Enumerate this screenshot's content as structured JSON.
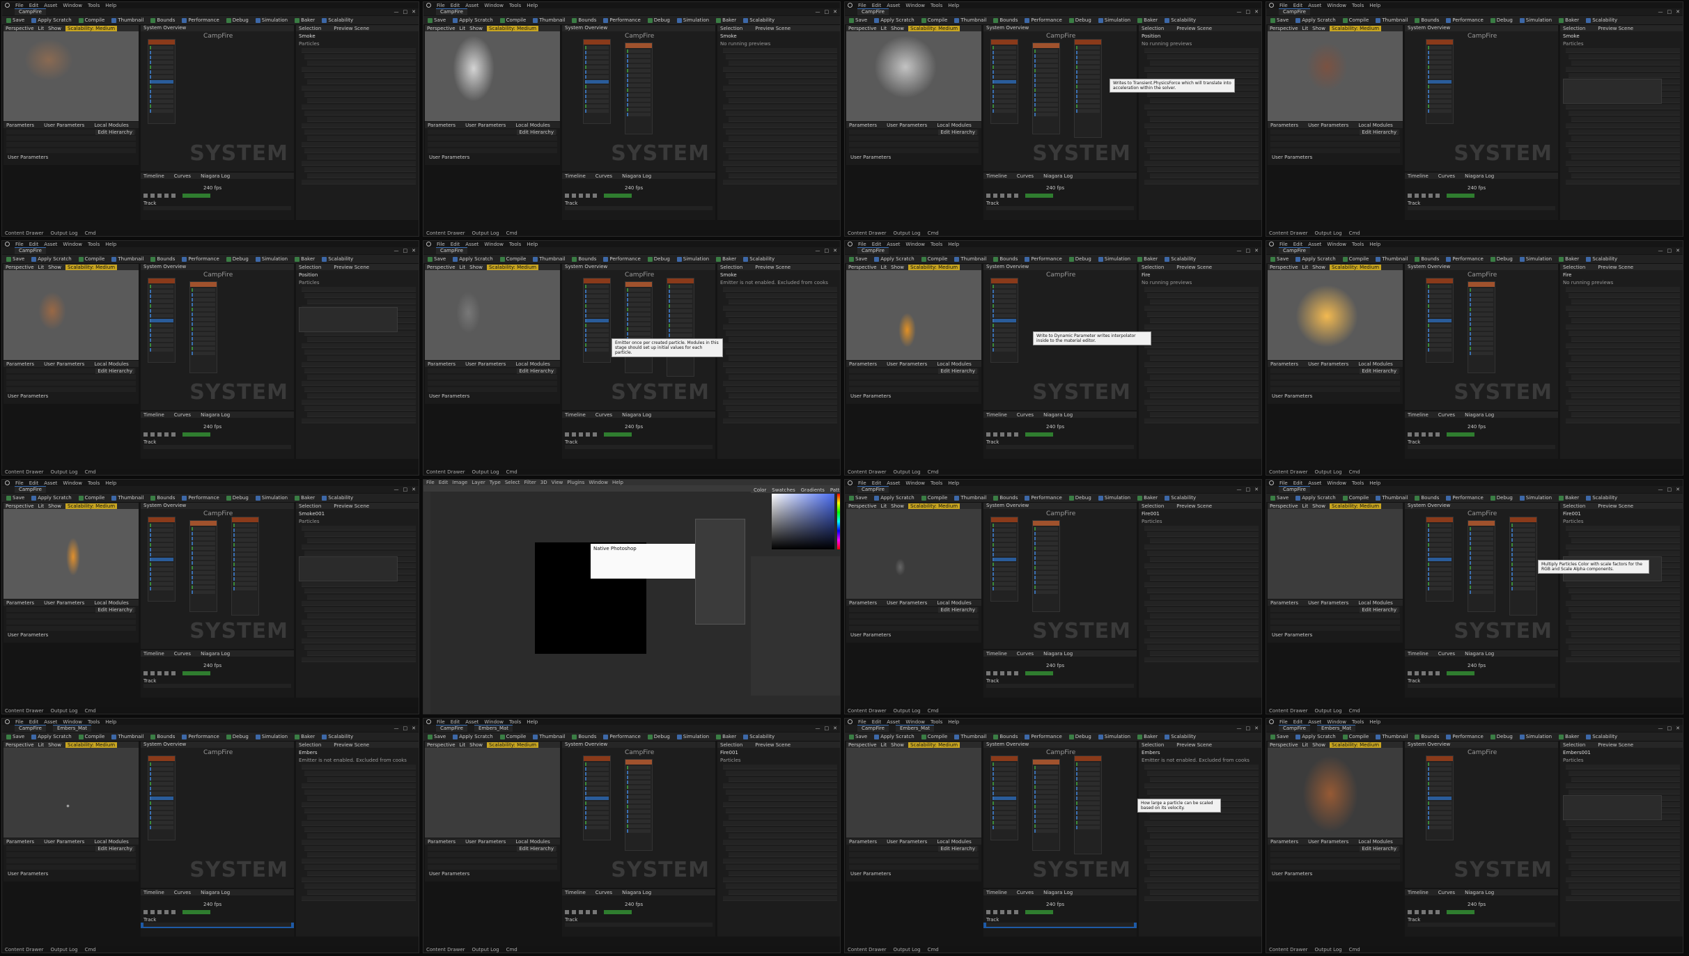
{
  "app": {
    "menu": [
      "File",
      "Edit",
      "Asset",
      "Window",
      "Tools",
      "Help"
    ],
    "window_buttons": [
      "—",
      "□",
      "✕"
    ]
  },
  "tabs": {
    "campfire": "CampFire",
    "embers": "Embers_Mat"
  },
  "toolbar": [
    "Save",
    "Apply Scratch",
    "Compile",
    "Thumbnail",
    "Bounds",
    "Performance",
    "Debug",
    "Simulation",
    "Baker",
    "Scalability"
  ],
  "viewport": {
    "perspective": "Perspective",
    "lit": "Lit",
    "show": "Show",
    "scalability": "Scalability: Medium"
  },
  "params": {
    "tabs": [
      "Parameters",
      "User Parameters",
      "Local Modules"
    ],
    "edit_hierarchy": "Edit Hierarchy",
    "user_params": "User Parameters"
  },
  "system": {
    "overview_tab": "System Overview",
    "name": "CampFire",
    "watermark": "SYSTEM"
  },
  "selection": {
    "tabs": [
      "Selection",
      "Preview Scene"
    ]
  },
  "timeline": {
    "tabs": [
      "Timeline",
      "Curves",
      "Niagara Log"
    ],
    "track": "Track",
    "fps": "240 fps"
  },
  "status": [
    "Content Drawer",
    "Output Log",
    "Cmd"
  ],
  "frames": [
    {
      "panel": "Smoke",
      "sub": "Particles",
      "tooltip": ""
    },
    {
      "panel": "Smoke",
      "sub": "No running previews",
      "tooltip": ""
    },
    {
      "panel": "Position",
      "sub": "No running previews",
      "tooltip": "Writes to Transient.PhysicsForce which will translate into acceleration within the solver."
    },
    {
      "panel": "Smoke",
      "sub": "Particles",
      "tooltip": ""
    },
    {
      "panel": "Position",
      "sub": "Particles",
      "tooltip": ""
    },
    {
      "panel": "Smoke",
      "sub": "Emitter is not enabled. Excluded from cooks",
      "tooltip": "Emitter once per created particle. Modules in this stage should set up initial values for each particle."
    },
    {
      "panel": "Fire",
      "sub": "No running previews",
      "tooltip": "Write to Dynamic Parameter writes interpolator inside to the material editor."
    },
    {
      "panel": "Fire",
      "sub": "No running previews",
      "tooltip": ""
    },
    {
      "panel": "Smoke001",
      "sub": "Particles",
      "tooltip": ""
    },
    {
      "panel": "",
      "sub": "",
      "tooltip": ""
    },
    {
      "panel": "Fire001",
      "sub": "Particles",
      "tooltip": ""
    },
    {
      "panel": "Fire001",
      "sub": "Particles",
      "tooltip": "Multiply Particles Color with scale factors for the RGB and Scale Alpha components."
    },
    {
      "panel": "Embers",
      "sub": "Emitter is not enabled. Excluded from cooks",
      "tooltip": ""
    },
    {
      "panel": "Fire001",
      "sub": "Particles",
      "tooltip": ""
    },
    {
      "panel": "Embers",
      "sub": "Emitter is not enabled. Excluded from cooks",
      "tooltip": "How large a particle can be scaled based on its velocity."
    },
    {
      "panel": "Embers001",
      "sub": "Particles",
      "tooltip": ""
    }
  ],
  "photoshop": {
    "menu": [
      "File",
      "Edit",
      "Image",
      "Layer",
      "Type",
      "Select",
      "Filter",
      "3D",
      "View",
      "Plugins",
      "Window",
      "Help"
    ],
    "panels": [
      "Color",
      "Swatches",
      "Gradients",
      "Patterns"
    ],
    "dialog_title": "Native Photoshop"
  }
}
